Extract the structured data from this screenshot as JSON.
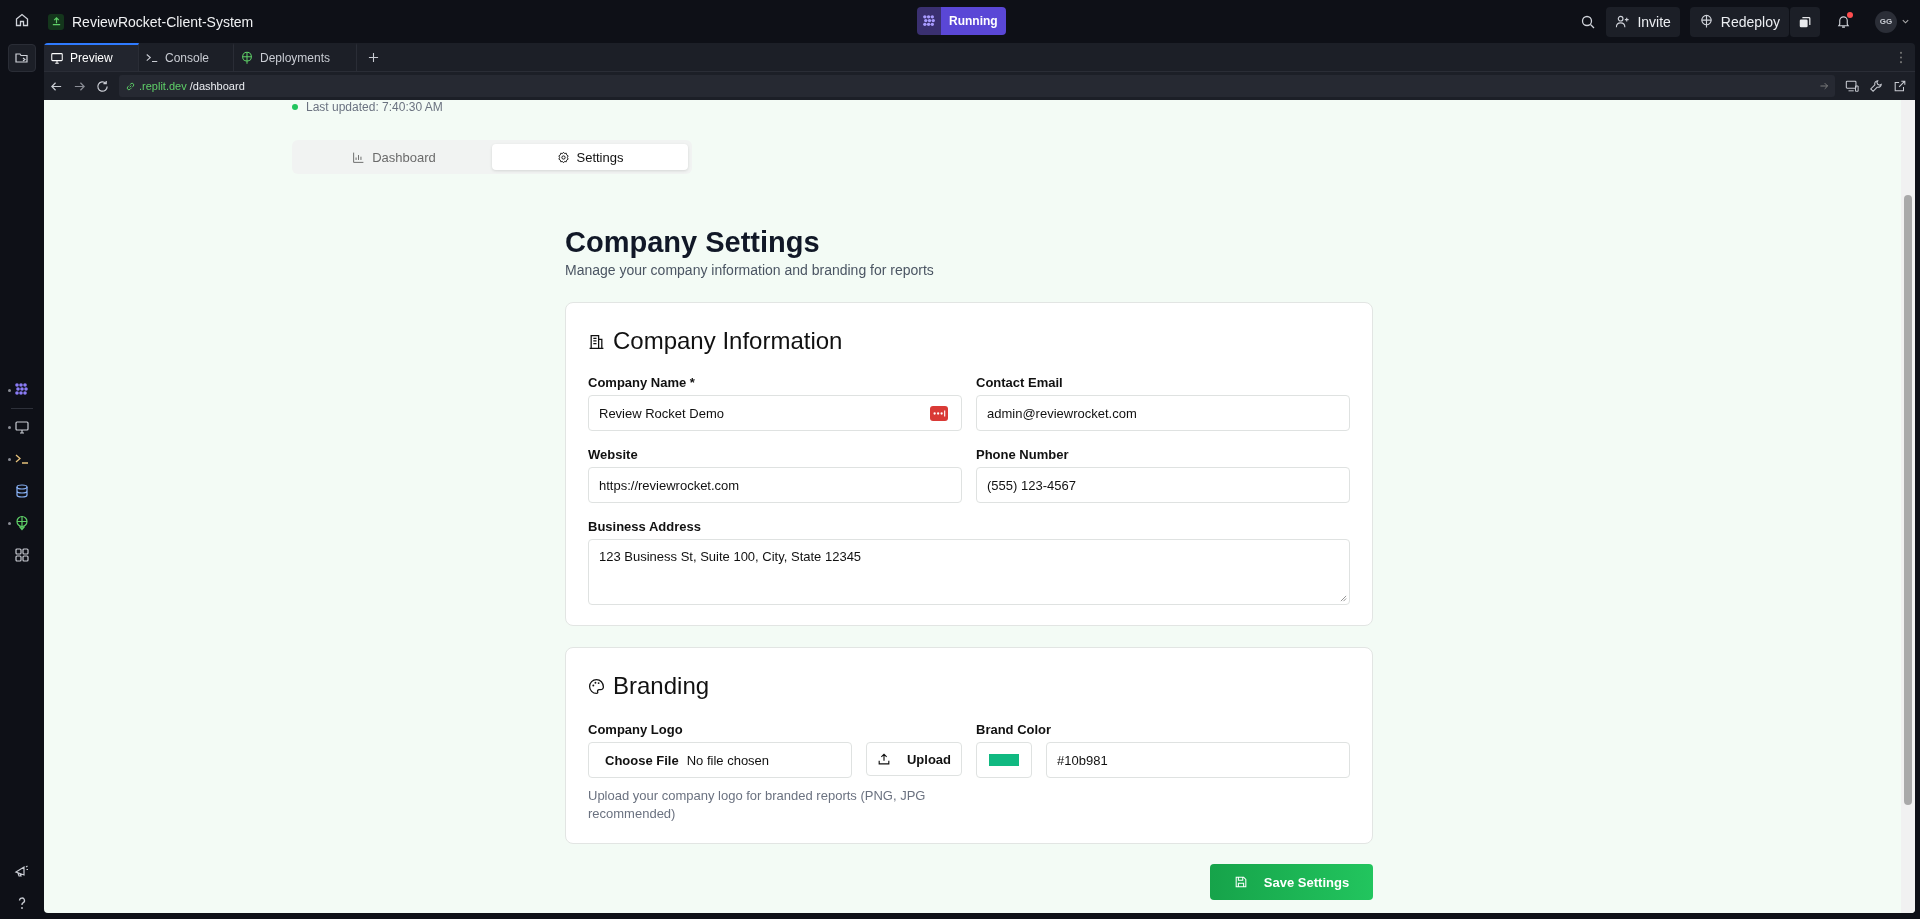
{
  "app_header": {
    "project_title": "ReviewRocket-Client-System",
    "run_status": "Running",
    "invite": "Invite",
    "redeploy": "Redeploy",
    "avatar_initials": "GG",
    "notifications_unread": true
  },
  "rail": [
    {
      "kind": "agent",
      "dot": true
    },
    {
      "kind": "preview",
      "dot": true
    },
    {
      "kind": "console",
      "dot": true
    },
    {
      "kind": "database",
      "dot": false
    },
    {
      "kind": "deployments",
      "dot": true
    },
    {
      "kind": "apps",
      "dot": false
    }
  ],
  "workspace_tabs": [
    {
      "label": "Preview",
      "kind": "preview",
      "selected": true
    },
    {
      "label": "Console",
      "kind": "console",
      "selected": false
    },
    {
      "label": "Deployments",
      "kind": "deployments",
      "selected": false
    }
  ],
  "address_bar": {
    "domain": ".replit.dev",
    "path": "/dashboard"
  },
  "page": {
    "last_updated": "Last updated: 7:40:30 AM",
    "tabs": [
      {
        "label": "Dashboard",
        "kind": "chart",
        "selected": false
      },
      {
        "label": "Settings",
        "kind": "gear",
        "selected": true
      }
    ],
    "title": "Company Settings",
    "subtitle": "Manage your company information and branding for reports",
    "company_information": {
      "title": "Company Information",
      "fields": [
        {
          "label": "Company Name *",
          "value": "Review Rocket Demo",
          "kind": "input",
          "autofill_badge": true
        },
        {
          "label": "Contact Email",
          "value": "admin@reviewrocket.com",
          "kind": "input",
          "autofill_badge": false
        },
        {
          "label": "Website",
          "value": "https://reviewrocket.com",
          "kind": "input",
          "autofill_badge": false
        },
        {
          "label": "Phone Number",
          "value": "(555) 123-4567",
          "kind": "input",
          "autofill_badge": false
        },
        {
          "label": "Business Address",
          "value": "123 Business St, Suite 100, City, State 12345",
          "kind": "textarea",
          "autofill_badge": false
        }
      ]
    },
    "branding": {
      "title": "Branding",
      "logo_label": "Company Logo",
      "file_button": "Choose File",
      "file_status": "No file chosen",
      "upload_button": "Upload",
      "logo_help": "Upload your company logo for branded reports (PNG, JPG recommended)",
      "color_label": "Brand Color",
      "color": "#10b981",
      "color_value": "#10b981"
    },
    "save_button": "Save Settings"
  }
}
